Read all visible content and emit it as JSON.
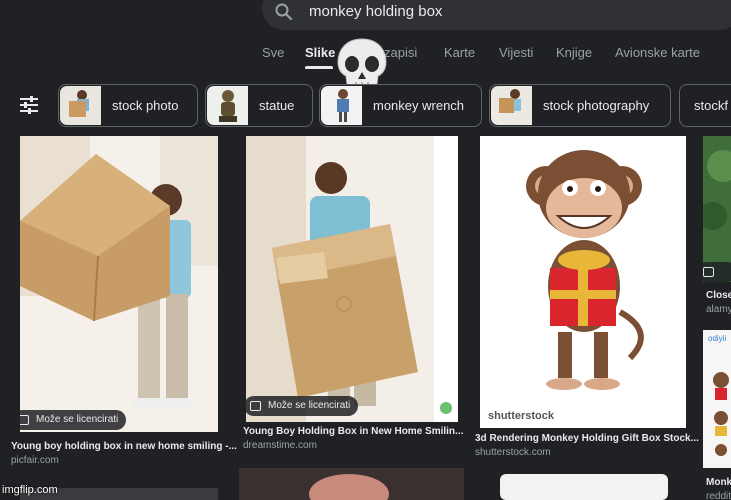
{
  "search": {
    "query": "monkey holding box"
  },
  "tabs": [
    {
      "label": "Sve"
    },
    {
      "label": "Slike"
    },
    {
      "label": "zapisi"
    },
    {
      "label": "Karte"
    },
    {
      "label": "Vijesti"
    },
    {
      "label": "Knjige"
    },
    {
      "label": "Avionske karte"
    }
  ],
  "chips": [
    {
      "label": "stock photo"
    },
    {
      "label": "statue"
    },
    {
      "label": "monkey wrench"
    },
    {
      "label": "stock photography"
    },
    {
      "label": "stockf"
    }
  ],
  "results": [
    {
      "badge": "Može se licencirati",
      "title": "Young boy holding box in new home smiling -...",
      "source": "picfair.com"
    },
    {
      "badge": "Može se licencirati",
      "title": "Young Boy Holding Box in New Home Smilin...",
      "source": "dreamstime.com"
    },
    {
      "title": "3d Rendering Monkey Holding Gift Box Stock...",
      "source": "shutterstock.com",
      "brand": "shutterstock"
    },
    {
      "title": "Close",
      "source": "alamy",
      "brand": "odiyii"
    },
    {
      "title": "Monk",
      "source": "reddit"
    }
  ],
  "watermark": "imgflip.com",
  "colors": {
    "background": "#202124",
    "chip_border": "#5f6368",
    "muted_text": "#9aa0a6"
  }
}
